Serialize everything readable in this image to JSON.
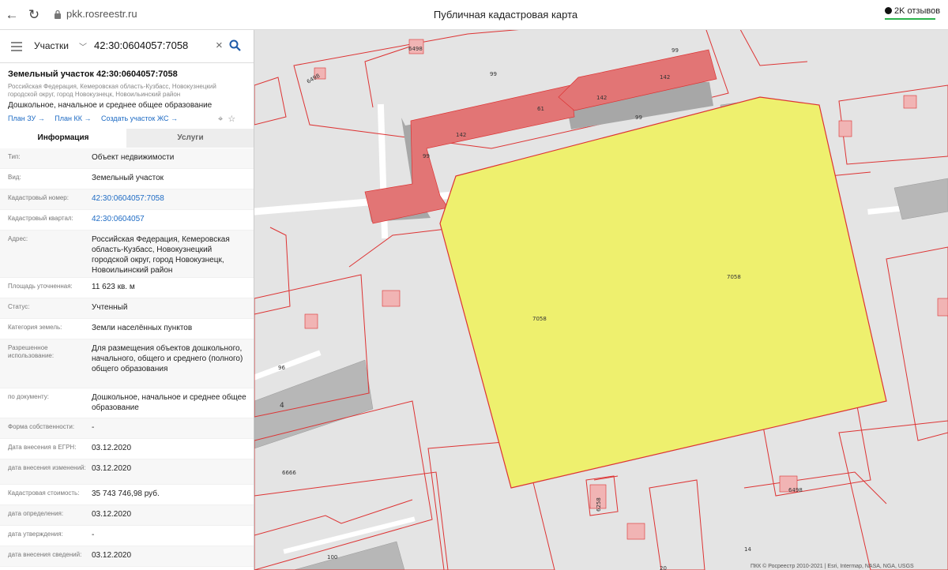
{
  "browser": {
    "url": "pkk.rosreestr.ru",
    "page_title": "Публичная кадастровая карта",
    "reviews": "2K отзывов"
  },
  "search": {
    "category": "Участки",
    "query": "42:30:0604057:7058"
  },
  "object": {
    "title": "Земельный участок 42:30:0604057:7058",
    "address_line": "Российская Федерация, Кемеровская область-Кузбасс, Новокузнецкий городской округ, город Новокузнецк, Новоильинский район",
    "use": "Дошкольное, начальное и среднее общее образование",
    "links": [
      "План ЗУ →",
      "План КК →",
      "Создать участок ЖС →"
    ]
  },
  "tabs": [
    "Информация",
    "Услуги"
  ],
  "rows": [
    {
      "k": "Тип:",
      "v": "Объект недвижимости"
    },
    {
      "k": "Вид:",
      "v": "Земельный участок"
    },
    {
      "k": "Кадастровый номер:",
      "v": "42:30:0604057:7058",
      "link": true
    },
    {
      "k": "Кадастровый квартал:",
      "v": "42:30:0604057",
      "link": true
    },
    {
      "k": "Адрес:",
      "v": "Российская Федерация, Кемеровская область-Кузбасс, Новокузнецкий городской округ, город Новокузнецк, Новоильинский район"
    },
    {
      "k": "Площадь уточненная:",
      "v": "11 623 кв. м"
    },
    {
      "k": "Статус:",
      "v": "Учтенный"
    },
    {
      "k": "Категория земель:",
      "v": "Земли населённых пунктов"
    },
    {
      "k": "Разрешенное использование:",
      "v": "Для размещения объектов дошкольного, начального, общего и среднего (полного) общего образования"
    },
    {
      "k": "по документу:",
      "v": "Дошкольное, начальное и среднее общее образование"
    },
    {
      "k": "Форма собственности:",
      "v": "-"
    },
    {
      "k": "Дата внесения в ЕГРН:",
      "v": "03.12.2020"
    },
    {
      "k": "дата внесения изменений:",
      "v": "03.12.2020"
    },
    {
      "k": "Кадастровая стоимость:",
      "v": "35 743 746,98 руб."
    },
    {
      "k": "дата определения:",
      "v": "03.12.2020"
    },
    {
      "k": "дата утверждения:",
      "v": "-"
    },
    {
      "k": "дата внесения сведений:",
      "v": "03.12.2020"
    }
  ],
  "map_labels": {
    "parcel": "7058",
    "building": "61",
    "b142": "142",
    "n99": "99",
    "n96": "96",
    "n4": "4",
    "n6666": "6666",
    "n100": "100",
    "n14": "14",
    "n20": "20",
    "n6498": "6498",
    "n6258": "6258"
  },
  "attribution": "ПКК © Росреестр 2010-2021 | Esri, Intermap, NASA, NGA, USGS",
  "colors": {
    "parcel_fill": "#eef06e",
    "parcel_stroke": "#d33",
    "building": "#e07070",
    "boundary": "#d33"
  }
}
